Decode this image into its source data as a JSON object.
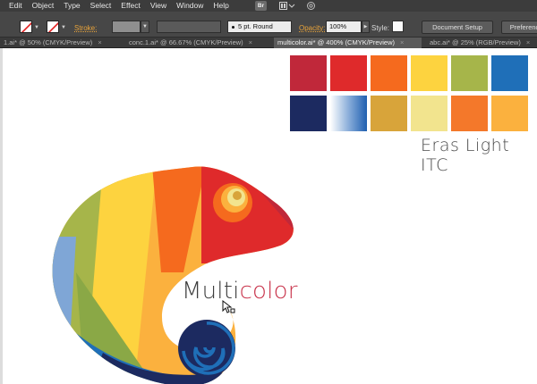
{
  "menu": {
    "items": [
      "Edit",
      "Object",
      "Type",
      "Select",
      "Effect",
      "View",
      "Window",
      "Help"
    ],
    "bridge_badge": "Br"
  },
  "control": {
    "stroke_label": "Stroke:",
    "brush_value": "5 pt. Round",
    "opacity_label": "Opacity:",
    "opacity_value": "100%",
    "style_label": "Style:",
    "document_setup_label": "Document Setup",
    "preferences_label": "Preferences"
  },
  "tabs": [
    {
      "label": "1.ai* @ 50% (CMYK/Preview)",
      "active": false
    },
    {
      "label": "conc.1.ai* @ 66.67% (CMYK/Preview)",
      "active": false
    },
    {
      "label": "multicolor.ai* @ 400% (CMYK/Preview)",
      "active": true
    },
    {
      "label": "abc.ai* @ 25% (RGB/Preview)",
      "active": false
    }
  ],
  "palette": {
    "colors": [
      "#c0283a",
      "#df2a2b",
      "#f56a1e",
      "#fdd33f",
      "#a6b54a",
      "#1f6fb8",
      "#1c2a60",
      "#7fa6d6",
      "#d8a43a",
      "#f2e48e",
      "#f4782a",
      "#fbb13e"
    ],
    "font_name": "Eras Light ITC"
  },
  "artwork": {
    "word_part_1": "Multi",
    "word_part_2": "color"
  }
}
